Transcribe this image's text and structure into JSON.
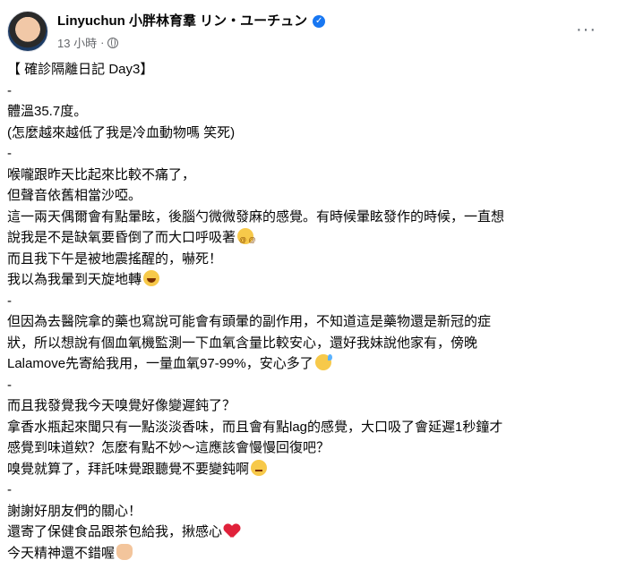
{
  "post": {
    "author": "Linyuchun 小胖林育羣 リン・ユーチュン",
    "time": "13 小時",
    "separator": "·",
    "more": "···",
    "lines": [
      "【 確診隔離日記 Day3】",
      "-",
      "體溫35.7度。",
      "(怎麼越來越低了我是冷血動物嗎 笑死)",
      "-",
      "喉嚨跟昨天比起來比較不痛了，",
      "但聲音依舊相當沙啞。",
      "這一兩天偶爾會有點暈眩，後腦勺微微發麻的感覺。有時候暈眩發作的時候，一直想",
      "說我是不是缺氧要昏倒了而大口呼吸著",
      "而且我下午是被地震搖醒的，嚇死！",
      "我以為我暈到天旋地轉",
      "-",
      "但因為去醫院拿的藥也寫說可能會有頭暈的副作用，不知道這是藥物還是新冠的症",
      "狀，所以想說有個血氧機監測一下血氧含量比較安心，還好我妹說他家有，傍晚",
      "Lalamove先寄給我用，一量血氧97-99%，安心多了",
      "-",
      "而且我發覺我今天嗅覺好像變遲鈍了？",
      "拿香水瓶起來聞只有一點淡淡香味，而且會有點lag的感覺，大口吸了會延遲1秒鐘才",
      "感覺到味道欸？怎麼有點不妙～這應該會慢慢回復吧？",
      "嗅覺就算了，拜託味覺跟聽覺不要變鈍啊",
      "-",
      "謝謝好朋友們的關心！",
      "還寄了保健食品跟茶包給我，揪感心",
      "今天精神還不錯喔"
    ],
    "emoji": {
      "8": "dizzy",
      "10": "laugh",
      "14": "sweat",
      "19": "sad",
      "22": "heart",
      "23": "victory"
    }
  }
}
